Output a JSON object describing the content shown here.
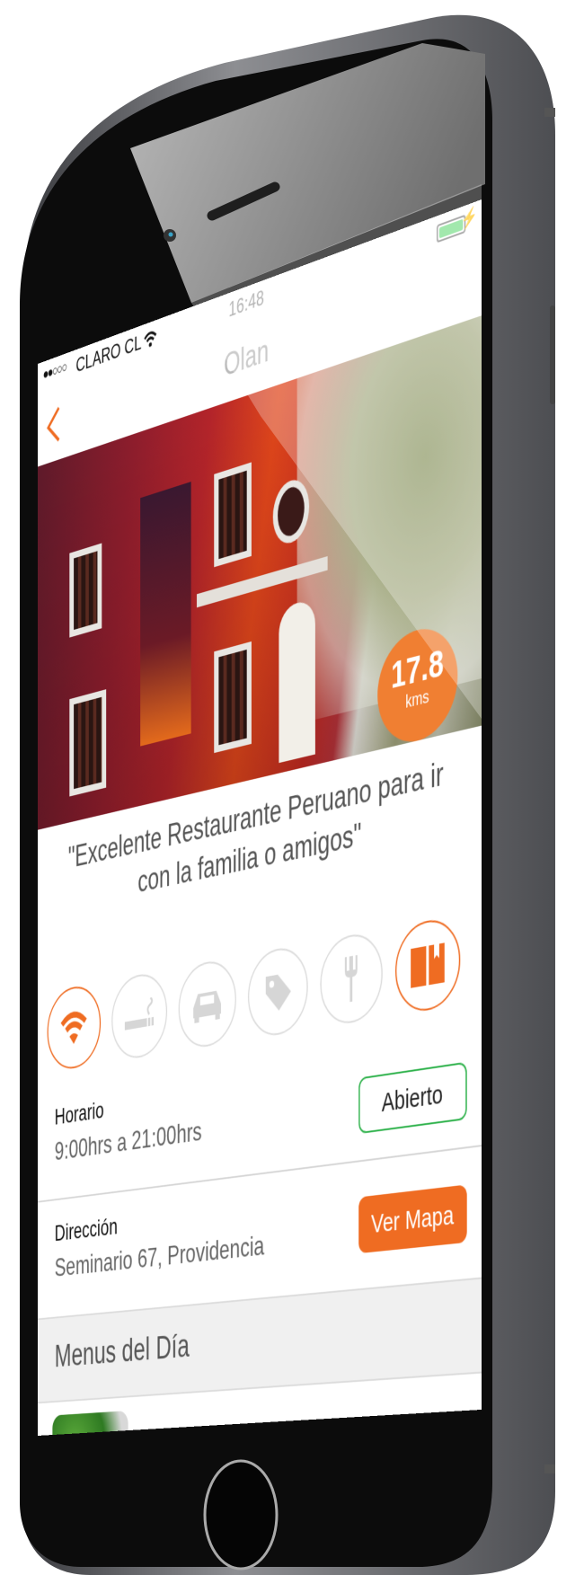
{
  "status_bar": {
    "signal_dots": "●●○○○",
    "carrier": "CLARO CL",
    "time": "16:48",
    "battery_color": "#7ee08e"
  },
  "nav": {
    "title": "Olan"
  },
  "hero": {
    "distance_value": "17.8",
    "distance_unit": "kms"
  },
  "quote": "\"Excelente Restaurante Peruano para ir con la familia o amigos\"",
  "amenities": [
    {
      "icon": "wifi-icon",
      "active": true
    },
    {
      "icon": "smoking-icon",
      "active": false
    },
    {
      "icon": "car-icon",
      "active": false
    },
    {
      "icon": "tag-icon",
      "active": false
    },
    {
      "icon": "fork-icon",
      "active": false
    },
    {
      "icon": "book-menu-icon",
      "active": true
    }
  ],
  "schedule": {
    "label": "Horario",
    "value": "9:00hrs a 21:00hrs",
    "status_button": "Abierto"
  },
  "address": {
    "label": "Dirección",
    "value": "Seminario 67, Providencia",
    "map_button": "Ver Mapa"
  },
  "menus_header": "Menus del Día",
  "colors": {
    "accent": "#ef6c22",
    "open_green": "#2fb24c",
    "inactive_icon": "#d0d0d0"
  }
}
